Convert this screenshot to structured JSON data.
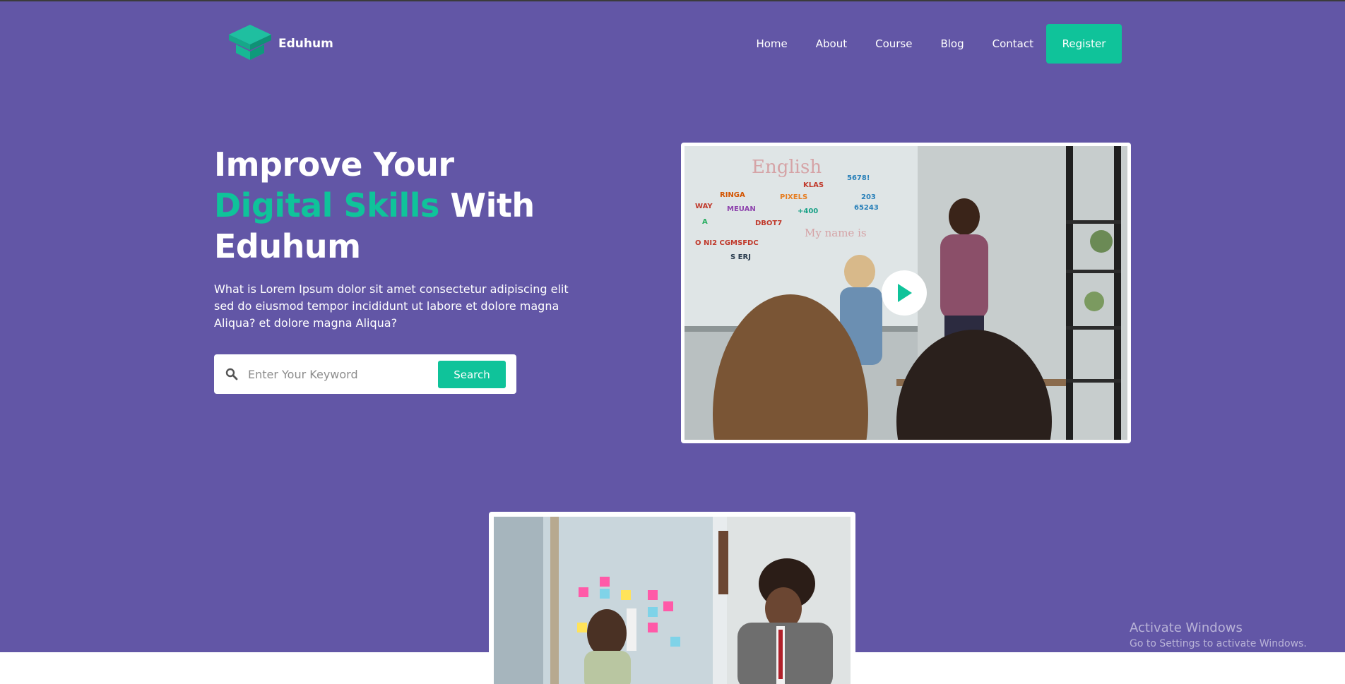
{
  "header": {
    "brand": "Eduhum",
    "nav": [
      {
        "label": "Home"
      },
      {
        "label": "About"
      },
      {
        "label": "Course"
      },
      {
        "label": "Blog"
      },
      {
        "label": "Contact"
      }
    ],
    "register_label": "Register"
  },
  "hero": {
    "headline_line1": "Improve Your",
    "headline_accent": "Digital Skills",
    "headline_line2_rest": " With",
    "headline_line3": "Eduhum",
    "description": "What is Lorem Ipsum dolor sit amet consectetur adipiscing elit sed do eiusmod tempor incididunt ut labore et dolore magna Aliqua? et dolore magna Aliqua?",
    "search": {
      "placeholder": "Enter Your Keyword",
      "button_label": "Search",
      "icon": "search-icon"
    },
    "video": {
      "icon": "play-icon"
    }
  },
  "watermark": {
    "title": "Activate Windows",
    "subtitle": "Go to Settings to activate Windows."
  },
  "colors": {
    "hero_bg": "#6256a6",
    "accent": "#0fc39a",
    "text_light": "#ffffff"
  }
}
